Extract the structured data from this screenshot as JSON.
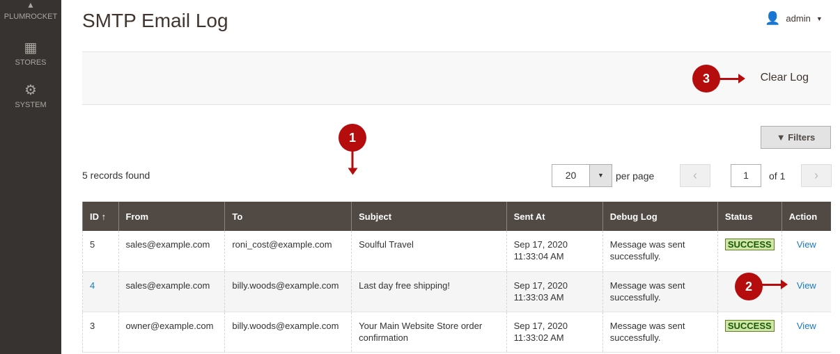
{
  "sidebar": {
    "items": [
      {
        "label": "PLUMROCKET",
        "icon": "plumrocket-logo-icon"
      },
      {
        "label": "STORES",
        "icon": "store-icon"
      },
      {
        "label": "SYSTEM",
        "icon": "gear-icon"
      }
    ]
  },
  "header": {
    "title": "SMTP Email Log",
    "user": "admin"
  },
  "actions": {
    "clear_log": "Clear Log",
    "filters": "Filters"
  },
  "markers": [
    "1",
    "2",
    "3"
  ],
  "grid": {
    "records": "5 records found",
    "per_page_value": "20",
    "per_page_label": "per page",
    "page": "1",
    "of": "of 1",
    "columns": [
      "ID",
      "From",
      "To",
      "Subject",
      "Sent At",
      "Debug Log",
      "Status",
      "Action"
    ],
    "rows": [
      {
        "id": "5",
        "from": "sales@example.com",
        "to": "roni_cost@example.com",
        "subject": "Soulful Travel",
        "date": "Sep 17, 2020",
        "time": "11:33:04 AM",
        "debug": "Message was sent successfully.",
        "status": "SUCCESS",
        "action": "View"
      },
      {
        "id": "4",
        "from": "sales@example.com",
        "to": "billy.woods@example.com",
        "subject": "Last day free shipping!",
        "date": "Sep 17, 2020",
        "time": "11:33:03 AM",
        "debug": "Message was sent successfully.",
        "status": "",
        "action": "View"
      },
      {
        "id": "3",
        "from": "owner@example.com",
        "to": "billy.woods@example.com",
        "subject": "Your Main Website Store order confirmation",
        "date": "Sep 17, 2020",
        "time": "11:33:02 AM",
        "debug": "Message was sent successfully.",
        "status": "SUCCESS",
        "action": "View"
      }
    ]
  },
  "colors": {
    "marker": "#b50d0d",
    "header_bg": "#514943",
    "sidebar_bg": "#373330",
    "link": "#1979c3"
  }
}
